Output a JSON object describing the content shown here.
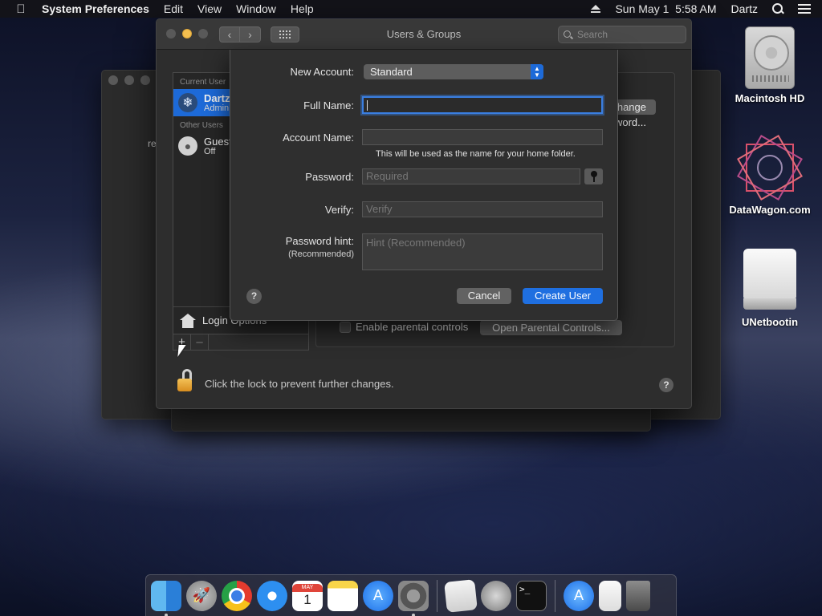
{
  "menubar": {
    "app_name": "System Preferences",
    "menus": [
      "Edit",
      "View",
      "Window",
      "Help"
    ],
    "clock": "Sun May 1  5:58 AM",
    "user": "Dartz"
  },
  "window": {
    "title": "Users & Groups",
    "search_placeholder": "Search"
  },
  "users": {
    "current_section": "Current User",
    "current": {
      "name": "Dartz",
      "role": "Admin"
    },
    "other_section": "Other Users",
    "others": [
      {
        "name": "Guest User",
        "role": "Off"
      }
    ],
    "login_options": "Login Options"
  },
  "panel": {
    "change_password": "Change Password...",
    "parental_checkbox": "Enable parental controls",
    "parental_checked": false,
    "open_parental": "Open Parental Controls...",
    "lock_text": "Click the lock to prevent further changes.",
    "partial_text": "re"
  },
  "sheet": {
    "new_account_label": "New Account:",
    "new_account_value": "Standard",
    "full_name_label": "Full Name:",
    "full_name_value": "",
    "account_name_label": "Account Name:",
    "account_name_value": "",
    "home_folder_note": "This will be used as the name for your home folder.",
    "password_label": "Password:",
    "password_placeholder": "Required",
    "verify_label": "Verify:",
    "verify_placeholder": "Verify",
    "hint_label": "Password hint:",
    "hint_sublabel": "(Recommended)",
    "hint_placeholder": "Hint (Recommended)",
    "help": "?",
    "cancel": "Cancel",
    "create": "Create User"
  },
  "desktop": {
    "icons": [
      {
        "label": "Macintosh HD",
        "icon": "hard-drive-icon"
      },
      {
        "label": "DataWagon.com",
        "icon": "datawagon-star-icon"
      },
      {
        "label": "UNetbootin",
        "icon": "usb-drive-icon"
      }
    ]
  },
  "dock": {
    "calendar_month": "MAY",
    "calendar_day": "1",
    "terminal_prompt": ">_",
    "items": [
      "finder",
      "launchpad",
      "chrome",
      "safari",
      "calendar",
      "notes",
      "app-store",
      "system-preferences",
      "textedit",
      "automator",
      "terminal",
      "app-store-downloads",
      "document",
      "trash"
    ]
  },
  "colors": {
    "accent": "#1f6fe0",
    "selection": "#1d6ad8",
    "window_bg": "#2d2d2d"
  }
}
